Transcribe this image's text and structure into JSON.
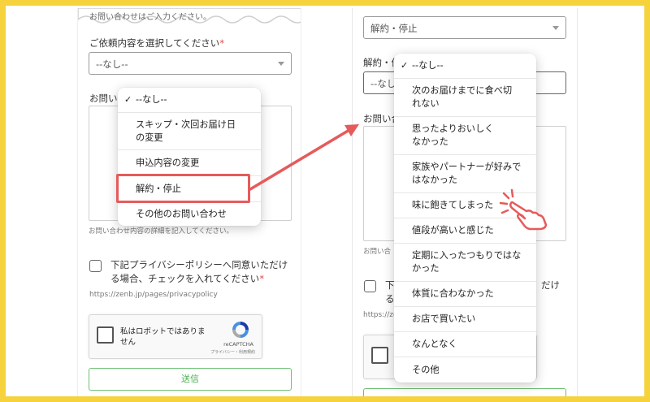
{
  "left": {
    "top_cut_text": "お問い合わせはご入力ください。",
    "request_label": "ご依頼内容を選択してください",
    "required_mark": "*",
    "select_value": "--なし--",
    "inquiry_label_partial": "お問い合",
    "textarea_help": "お問い合わせ内容の詳細を記入してください。",
    "privacy_text_1": "下記プライバシーポリシーへ同意いただけ",
    "privacy_text_2": "る場合、チェックを入れてください",
    "privacy_url": "https://zenb.jp/pages/privacypolicy",
    "captcha_text": "私はロボットではありません",
    "captcha_brand": "reCAPTCHA",
    "captcha_links": "プライバシー・利用規約",
    "submit_label": "送信",
    "dropdown": [
      {
        "label": "--なし--",
        "selected": true
      },
      {
        "label": "スキップ・次回お届け日の変更",
        "selected": false
      },
      {
        "label": "申込内容の変更",
        "selected": false
      },
      {
        "label": "解約・停止",
        "selected": false,
        "highlighted": true
      },
      {
        "label": "その他のお問い合わせ",
        "selected": false
      }
    ]
  },
  "right": {
    "top_select_value": "解約・停止",
    "reason_label_partial": "解約・停",
    "reason_select_value": "--なし",
    "inquiry_label_partial": "お問い合",
    "textarea_help_partial": "お問い合",
    "privacy_partial_1": "下",
    "privacy_partial_1_end": "だけ",
    "privacy_partial_2": "る",
    "privacy_url_partial": "https://ze",
    "submit_partial": "",
    "dropdown": [
      {
        "label": "--なし--",
        "selected": true
      },
      {
        "label": "次のお届けまでに食べ切れない",
        "selected": false
      },
      {
        "label": "思ったよりおいしくなかった",
        "selected": false
      },
      {
        "label": "家族やパートナーが好みではなかった",
        "selected": false
      },
      {
        "label": "味に飽きてしまった",
        "selected": false,
        "pointed": true
      },
      {
        "label": "値段が高いと感じた",
        "selected": false
      },
      {
        "label": "定期に入ったつもりではなかった",
        "selected": false
      },
      {
        "label": "体質に合わなかった",
        "selected": false
      },
      {
        "label": "お店で買いたい",
        "selected": false
      },
      {
        "label": "なんとなく",
        "selected": false
      },
      {
        "label": "その他",
        "selected": false
      }
    ]
  },
  "colors": {
    "background": "#f6d23c",
    "highlight": "#e55b5b",
    "submit_green": "#4caf50",
    "required_red": "#e04848"
  },
  "icons": {
    "check": "check-icon",
    "caret": "caret-down-icon",
    "recaptcha": "recaptcha-logo-icon",
    "pointer": "pointing-hand-icon",
    "arrow": "arrow-icon"
  }
}
